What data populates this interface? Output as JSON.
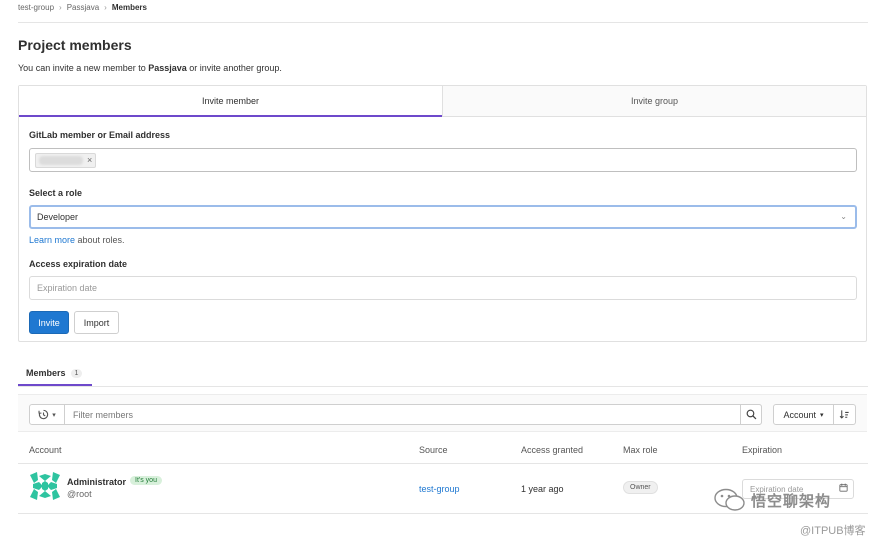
{
  "breadcrumb": {
    "items": [
      "test-group",
      "Passjava",
      "Members"
    ]
  },
  "page": {
    "title": "Project members",
    "subtitle_prefix": "You can invite a new member to ",
    "subtitle_project": "Passjava",
    "subtitle_suffix": " or invite another group."
  },
  "invite_tabs": {
    "invite_member": "Invite member",
    "invite_group": "Invite group"
  },
  "form": {
    "member_label": "GitLab member or Email address",
    "role_label": "Select a role",
    "role_value": "Developer",
    "learn_more_link": "Learn more",
    "learn_more_suffix": " about roles.",
    "expiration_label": "Access expiration date",
    "expiration_placeholder": "Expiration date",
    "invite_button": "Invite",
    "import_button": "Import"
  },
  "members_tab": {
    "label": "Members",
    "count": "1"
  },
  "filter": {
    "placeholder": "Filter members",
    "sort_label": "Account"
  },
  "table": {
    "headers": [
      "Account",
      "Source",
      "Access granted",
      "Max role",
      "Expiration"
    ],
    "rows": [
      {
        "name": "Administrator",
        "badge": "It's you",
        "handle": "@root",
        "source": "test-group",
        "granted": "1 year ago",
        "max_role": "Owner",
        "expiration_placeholder": "Expiration date"
      }
    ]
  },
  "watermark": {
    "line1": "悟空聊架构",
    "line2": "@ITPUB博客"
  },
  "colors": {
    "primary": "#1f78d1",
    "tab_accent": "#6e49cb",
    "avatar": "#2ec4a0"
  }
}
